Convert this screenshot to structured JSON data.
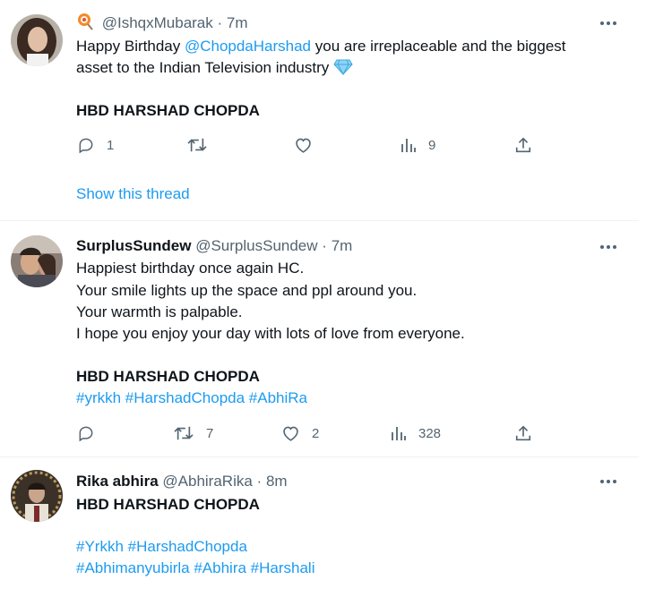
{
  "tweets": [
    {
      "name_prefix_emoji": "lollipop",
      "name": "",
      "handle": "@IshqxMubarak",
      "dot": "·",
      "time": "7m",
      "text_line1_a": "Happy Birthday ",
      "text_line1_mention": "@ChopdaHarshad",
      "text_line1_b": " you are irreplaceable and the biggest",
      "text_line2": "asset to the Indian Television industry",
      "text_line2_emoji": "gem",
      "bold_line": "HBD HARSHAD CHOPDA",
      "replies": "1",
      "retweets": "",
      "likes": "",
      "views": "9",
      "show_thread": "Show this thread"
    },
    {
      "name": "SurplusSundew",
      "handle": "@SurplusSundew",
      "dot": "·",
      "time": "7m",
      "lines": [
        "Happiest birthday once again HC.",
        "Your smile lights up the space and ppl around you.",
        "Your warmth is palpable.",
        "I hope you enjoy your day with lots of love from everyone."
      ],
      "bold_line": "HBD HARSHAD CHOPDA",
      "hashtags": "#yrkkh #HarshadChopda #AbhiRa",
      "replies": "",
      "retweets": "7",
      "likes": "2",
      "views": "328"
    },
    {
      "name": "Rika abhira",
      "handle": "@AbhiraRika",
      "dot": "·",
      "time": "8m",
      "bold_line": "HBD HARSHAD CHOPDA",
      "hashtags_line1": "#Yrkkh #HarshadChopda",
      "hashtags_line2": "#Abhimanyubirla #Abhira #Harshali"
    }
  ],
  "colors": {
    "accent": "#1d9bf0",
    "secondary_text": "#536471",
    "divider": "#eff3f4"
  },
  "icons": [
    "lollipop-icon",
    "gem-icon",
    "more-icon",
    "reply-icon",
    "retweet-icon",
    "like-icon",
    "views-icon",
    "share-icon"
  ]
}
